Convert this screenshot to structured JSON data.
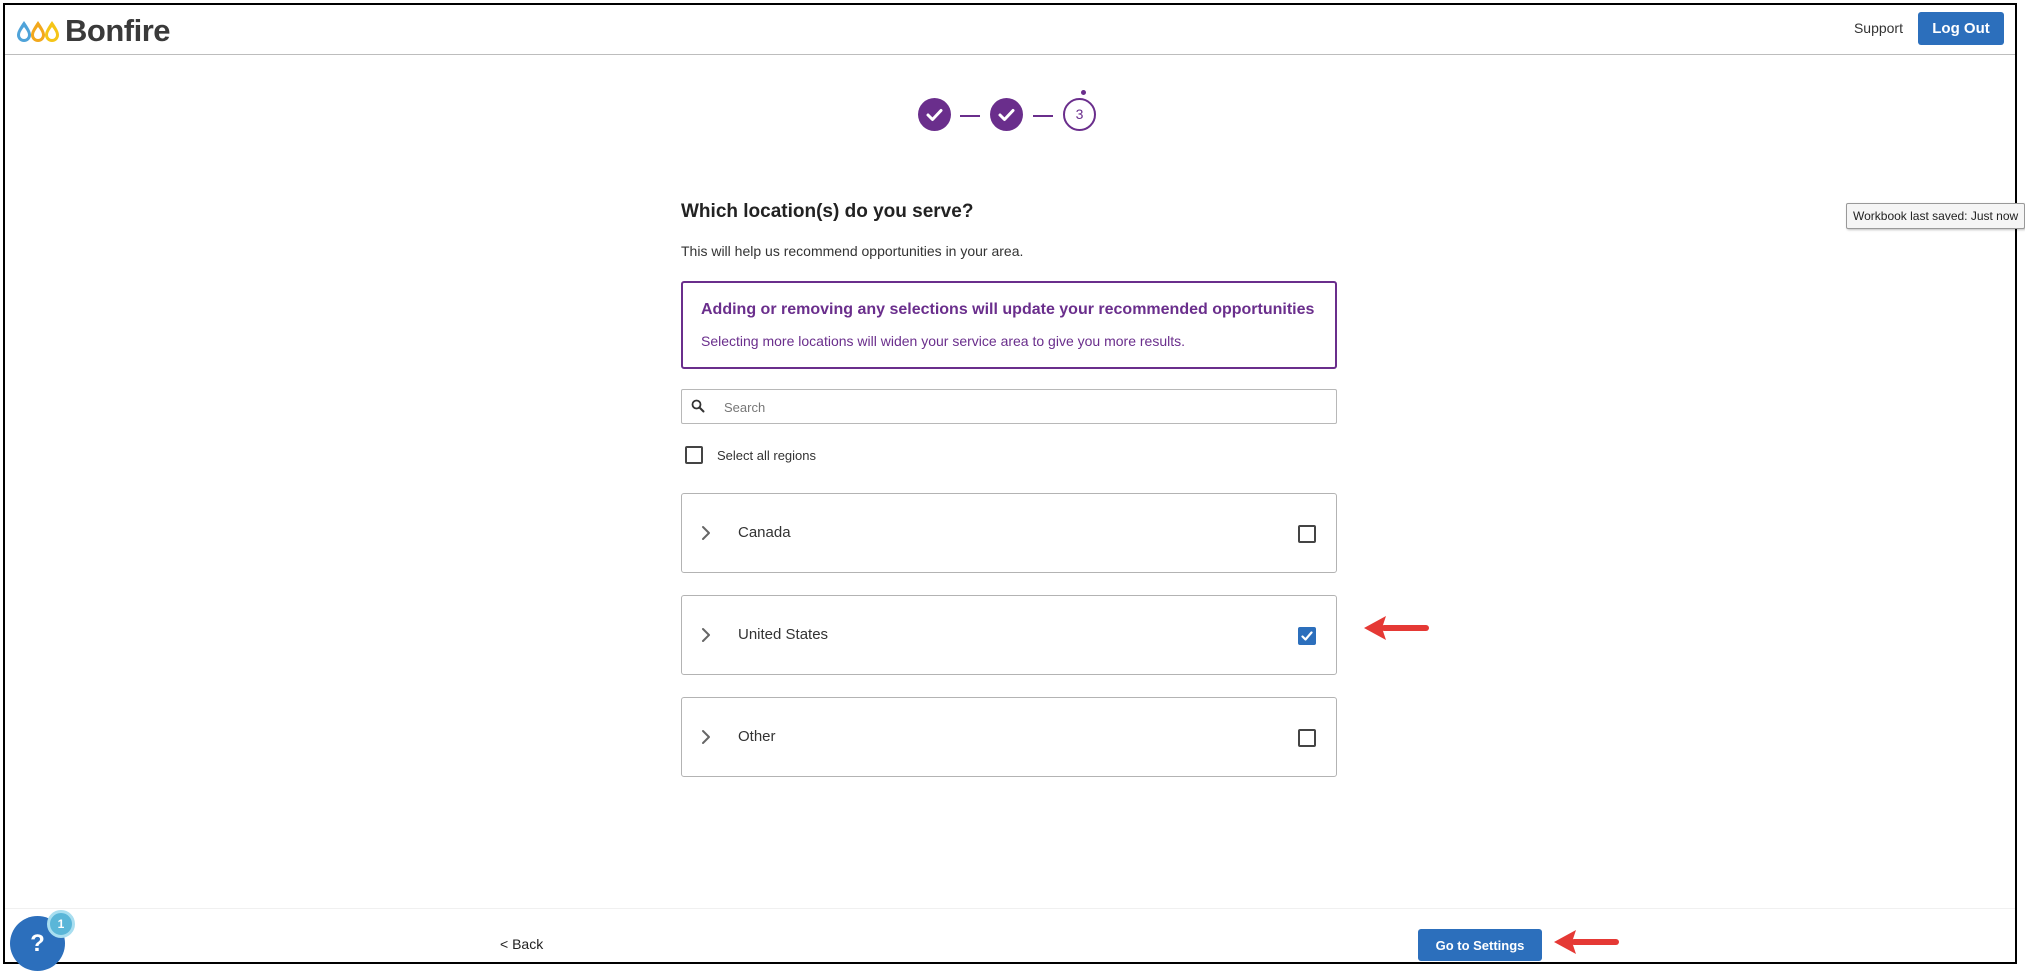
{
  "header": {
    "brand": "Bonfire",
    "support_label": "Support",
    "logout_label": "Log Out"
  },
  "stepper": {
    "current_step": "3",
    "completed_steps": 2
  },
  "question": {
    "title": "Which location(s) do you serve?",
    "subtitle": "This will help us recommend opportunities in your area."
  },
  "notice": {
    "title": "Adding or removing any selections will update your recommended opportunities",
    "text": "Selecting more locations will widen your service area to give you more results."
  },
  "search": {
    "placeholder": "Search",
    "value": ""
  },
  "select_all": {
    "label": "Select all regions",
    "checked": false
  },
  "regions": [
    {
      "label": "Canada",
      "checked": false
    },
    {
      "label": "United States",
      "checked": true
    },
    {
      "label": "Other",
      "checked": false
    }
  ],
  "tooltip": {
    "text": "Workbook last saved: Just now"
  },
  "footer": {
    "help_label": "?",
    "help_badge": "1",
    "back_label": "< Back",
    "settings_label": "Go to Settings"
  },
  "colors": {
    "brand_purple": "#6a2e8c",
    "primary_blue": "#2c6fbc",
    "annotation_red": "#e53935"
  }
}
